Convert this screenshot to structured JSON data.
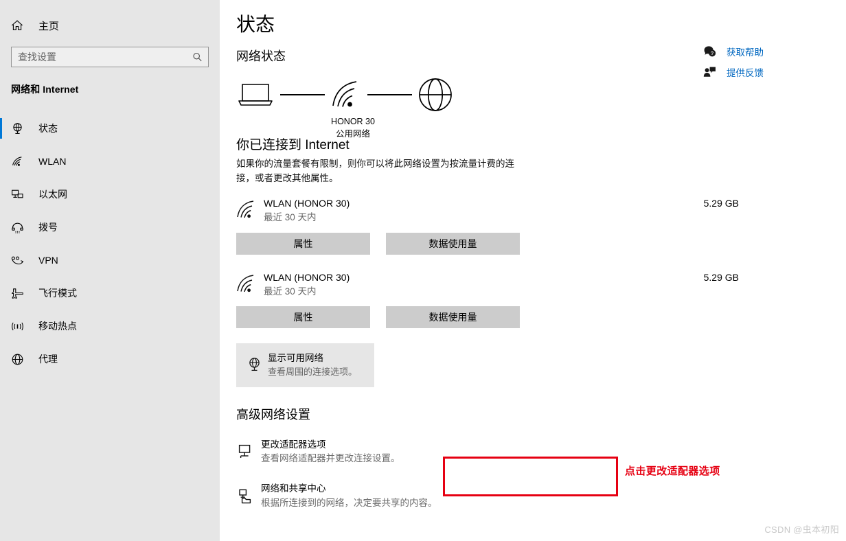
{
  "sidebar": {
    "home": {
      "label": "主页",
      "icon": "home-icon"
    },
    "search": {
      "placeholder": "查找设置",
      "value": "",
      "icon": "search-icon"
    },
    "category_title": "网络和 Internet",
    "items": [
      {
        "label": "状态",
        "icon": "status-icon",
        "active": true
      },
      {
        "label": "WLAN",
        "icon": "wifi-icon",
        "active": false
      },
      {
        "label": "以太网",
        "icon": "ethernet-icon",
        "active": false
      },
      {
        "label": "拨号",
        "icon": "dialup-icon",
        "active": false
      },
      {
        "label": "VPN",
        "icon": "vpn-icon",
        "active": false
      },
      {
        "label": "飞行模式",
        "icon": "airplane-icon",
        "active": false
      },
      {
        "label": "移动热点",
        "icon": "hotspot-icon",
        "active": false
      },
      {
        "label": "代理",
        "icon": "proxy-icon",
        "active": false
      }
    ]
  },
  "main": {
    "page_title": "状态",
    "network_status_heading": "网络状态",
    "diagram": {
      "device_icon": "laptop-icon",
      "network_icon": "wifi-icon",
      "internet_icon": "globe-icon",
      "network_name": "HONOR 30",
      "network_type": "公用网络"
    },
    "connection": {
      "title": "你已连接到 Internet",
      "description": "如果你的流量套餐有限制，则你可以将此网络设置为按流量计费的连接，或者更改其他属性。"
    },
    "adapters": [
      {
        "icon": "wifi-icon",
        "name": "WLAN (HONOR 30)",
        "period": "最近 30 天内",
        "usage": "5.29 GB",
        "buttons": {
          "properties": "属性",
          "data_usage": "数据使用量"
        }
      },
      {
        "icon": "wifi-icon",
        "name": "WLAN (HONOR 30)",
        "period": "最近 30 天内",
        "usage": "5.29 GB",
        "buttons": {
          "properties": "属性",
          "data_usage": "数据使用量"
        }
      }
    ],
    "show_networks_tile": {
      "icon": "globe-monitor-icon",
      "title": "显示可用网络",
      "subtitle": "查看周围的连接选项。"
    },
    "advanced": {
      "heading": "高级网络设置",
      "items": [
        {
          "icon": "monitor-icon",
          "title": "更改适配器选项",
          "subtitle": "查看网络适配器并更改连接设置。",
          "highlighted": true
        },
        {
          "icon": "share-folder-icon",
          "title": "网络和共享中心",
          "subtitle": "根据所连接到的网络，决定要共享的内容。",
          "highlighted": false
        }
      ]
    }
  },
  "annotation": {
    "note_text": "点击更改适配器选项",
    "color": "#e60012"
  },
  "help_panel": {
    "links": [
      {
        "label": "获取帮助",
        "icon": "help-question-icon"
      },
      {
        "label": "提供反馈",
        "icon": "feedback-person-icon"
      }
    ],
    "link_color": "#0067c0"
  },
  "watermark": {
    "text": "CSDN @虫本初阳"
  },
  "colors": {
    "sidebar_bg": "#e6e6e6",
    "accent": "#0078d7",
    "button_bg": "#cccccc",
    "annotation_red": "#e60012",
    "link_blue": "#0067c0"
  }
}
